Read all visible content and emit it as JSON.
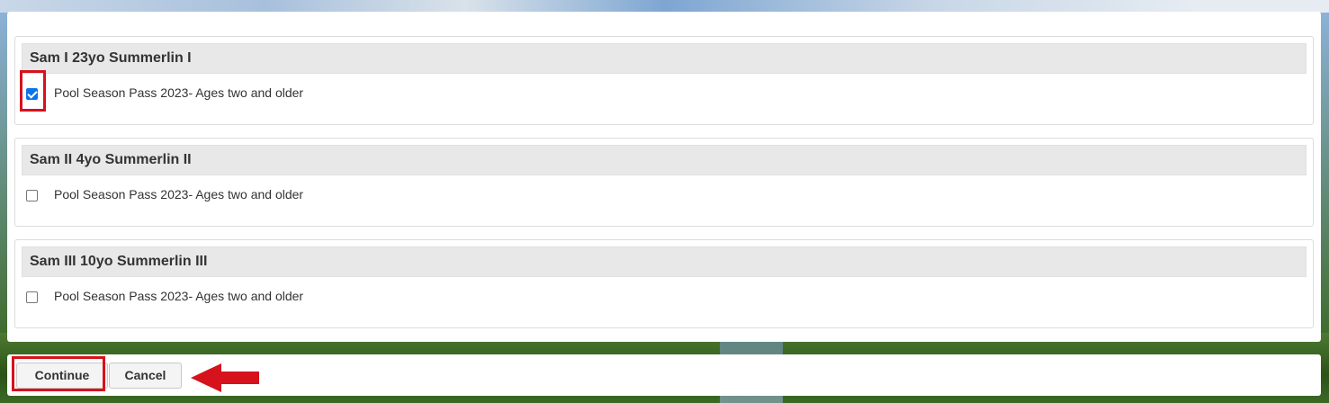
{
  "members": [
    {
      "name": "Sam I 23yo Summerlin I",
      "option_label": "Pool Season Pass 2023- Ages two and older",
      "checked": true
    },
    {
      "name": "Sam II 4yo Summerlin II",
      "option_label": "Pool Season Pass 2023- Ages two and older",
      "checked": false
    },
    {
      "name": "Sam III 10yo Summerlin III",
      "option_label": "Pool Season Pass 2023- Ages two and older",
      "checked": false
    }
  ],
  "footer": {
    "continue_label": "Continue",
    "cancel_label": "Cancel"
  },
  "colors": {
    "annotation_red": "#d6121c",
    "checkbox_blue": "#0b74e8",
    "header_bg": "#e8e8e8"
  },
  "icons": {
    "annotation_arrow": "red-left-arrow-icon"
  }
}
